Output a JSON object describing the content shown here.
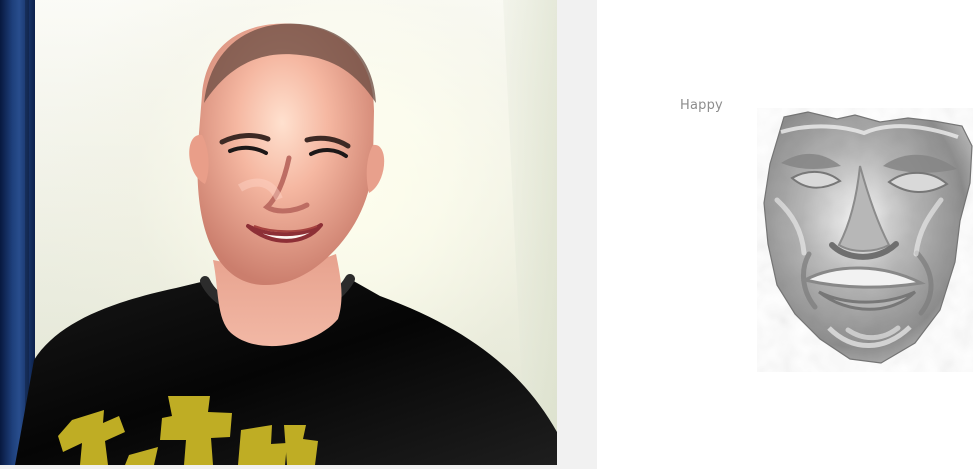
{
  "emotion_panel": {
    "label": "Happy"
  },
  "icons": {
    "webcam": "webcam-feed-icon",
    "face_mesh": "face-mesh-icon"
  },
  "colors": {
    "canvas_background": "#f1f1f1",
    "mesh_background": "#ffffff",
    "label_text": "#8d8d8d",
    "mesh_surface": "#a9a9a9"
  }
}
